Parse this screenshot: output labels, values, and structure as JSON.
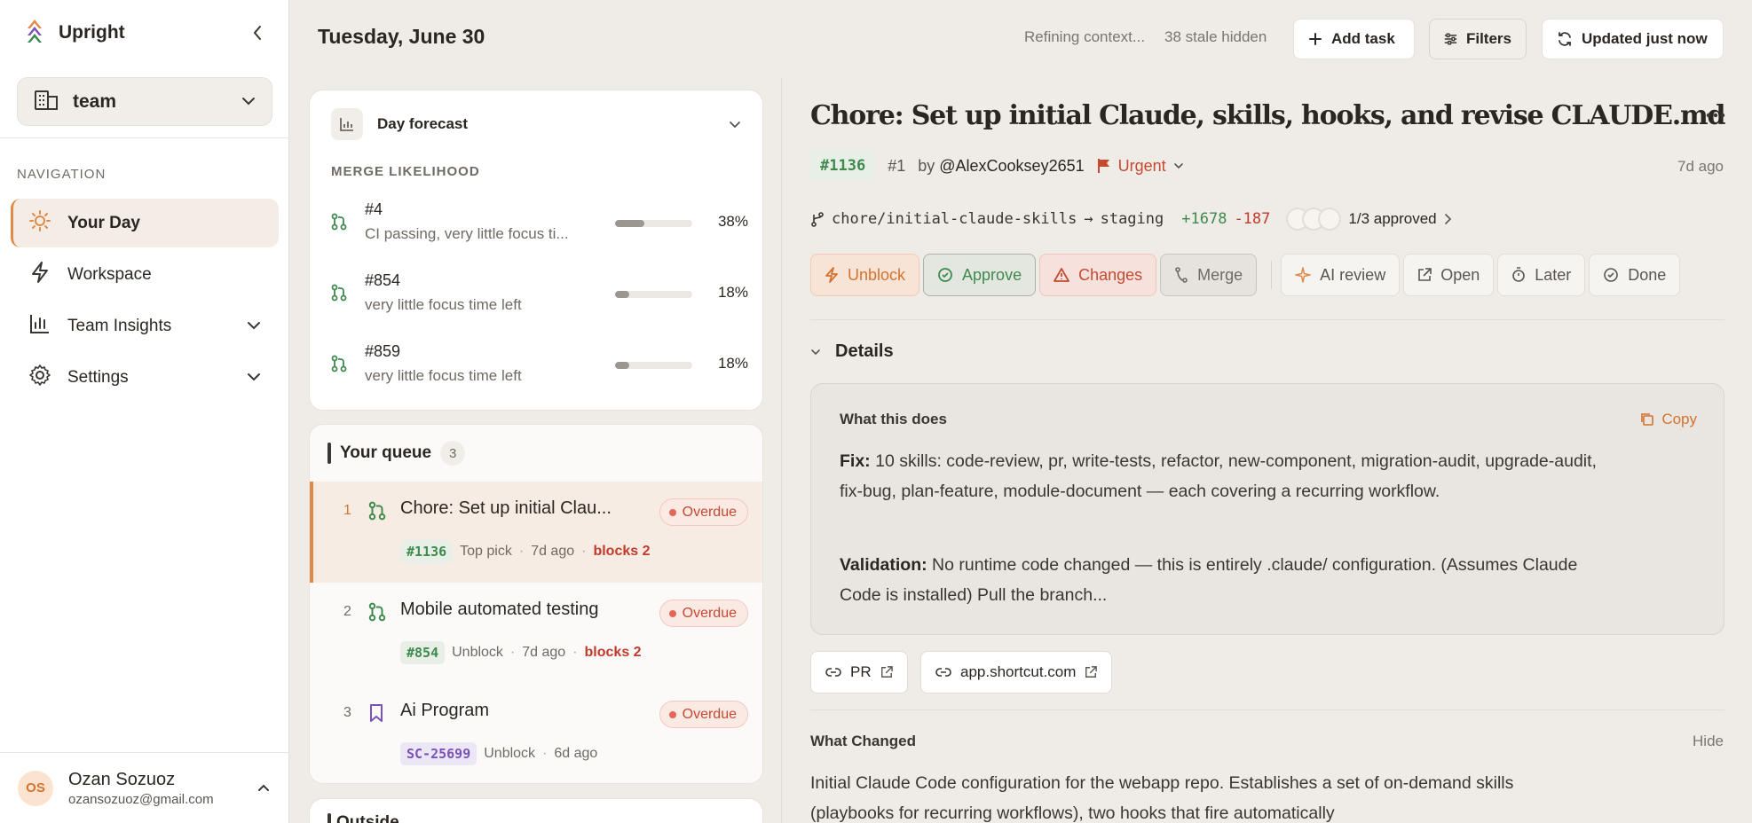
{
  "brand": {
    "name": "Upright"
  },
  "team_select": {
    "label": "team"
  },
  "nav": {
    "heading": "NAVIGATION",
    "items": [
      {
        "label": "Your Day",
        "icon": "sun-icon",
        "active": true
      },
      {
        "label": "Workspace",
        "icon": "bolt-icon"
      },
      {
        "label": "Team Insights",
        "icon": "bar-chart-icon",
        "expandable": true
      },
      {
        "label": "Settings",
        "icon": "gear-icon",
        "expandable": true
      }
    ]
  },
  "user": {
    "initials": "OS",
    "name": "Ozan Sozuoz",
    "email": "ozansozuoz@gmail.com"
  },
  "topbar": {
    "date": "Tuesday, June 30",
    "status": "Refining context...",
    "stale": "38 stale hidden",
    "add_task": "Add task",
    "filters": "Filters",
    "updated": "Updated just now"
  },
  "forecast": {
    "title": "Day forecast",
    "merge_label": "MERGE LIKELIHOOD",
    "rows": [
      {
        "id": "#4",
        "desc": "CI passing, very little focus ti...",
        "pct_label": "38%",
        "pct": 0.38
      },
      {
        "id": "#854",
        "desc": "very little focus time left",
        "pct_label": "18%",
        "pct": 0.18
      },
      {
        "id": "#859",
        "desc": "very little focus time left",
        "pct_label": "18%",
        "pct": 0.18
      }
    ]
  },
  "queue": {
    "title": "Your queue",
    "count": "3",
    "items": [
      {
        "num": "1",
        "title": "Chore: Set up initial Clau...",
        "badge": "Overdue",
        "id": "#1136",
        "tag": "Top pick",
        "age": "7d ago",
        "blocks": "blocks 2",
        "icon": "pull-request-icon"
      },
      {
        "num": "2",
        "title": "Mobile automated testing",
        "badge": "Overdue",
        "id": "#854",
        "tag": "Unblock",
        "age": "7d ago",
        "blocks": "blocks 2",
        "icon": "pull-request-icon"
      },
      {
        "num": "3",
        "title": "Ai Program",
        "badge": "Overdue",
        "id": "SC-25699",
        "tag": "Unblock",
        "age": "6d ago",
        "icon": "bookmark-icon"
      }
    ]
  },
  "next_card": {
    "title": "Outside"
  },
  "detail": {
    "title": "Chore: Set up initial Claude, skills, hooks, and revise CLAUDE.md",
    "id": "#1136",
    "number": "#1",
    "by": "by",
    "author": "@AlexCooksey2651",
    "priority": "Urgent",
    "age": "7d ago",
    "branch_from": "chore/initial-claude-skills",
    "arrow": "→",
    "branch_to": "staging",
    "additions": "+1678",
    "deletions": "-187",
    "approved": "1/3 approved",
    "actions": {
      "unblock": "Unblock",
      "approve": "Approve",
      "changes": "Changes",
      "merge": "Merge",
      "ai_review": "AI review",
      "open": "Open",
      "later": "Later",
      "done": "Done"
    },
    "details_label": "Details",
    "explain": {
      "heading": "What this does",
      "copy": "Copy",
      "fix_label": "Fix:",
      "fix_text": "10 skills: code-review, pr, write-tests, refactor, new-component, migration-audit, upgrade-audit, fix-bug, plan-feature, module-document — each covering a recurring workflow.",
      "validation_label": "Validation:",
      "validation_text": "No runtime code changed — this is entirely .claude/ configuration. (Assumes Claude Code is installed) Pull the branch..."
    },
    "links": {
      "pr": "PR",
      "shortcut": "app.shortcut.com"
    },
    "what_changed": {
      "heading": "What Changed",
      "hide": "Hide",
      "text": "Initial Claude Code configuration for the webapp repo. Establishes a set of on-demand skills (playbooks for recurring workflows), two hooks that fire automatically"
    }
  },
  "colors": {
    "accent": "#e08a4a",
    "green": "#3e8a4e",
    "red": "#c44a32",
    "purple": "#7a52b8"
  }
}
